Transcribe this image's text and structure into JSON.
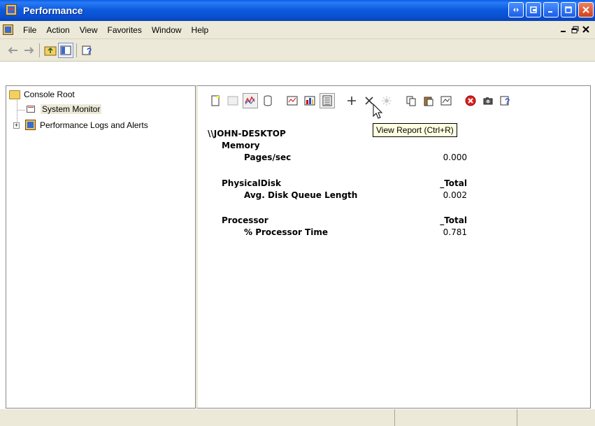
{
  "window": {
    "title": "Performance"
  },
  "menu": {
    "items": [
      "File",
      "Action",
      "View",
      "Favorites",
      "Window",
      "Help"
    ],
    "mdi": [
      "_",
      "ø",
      "x"
    ]
  },
  "tree": {
    "items": [
      {
        "label": "Console Root"
      },
      {
        "label": "System Monitor"
      },
      {
        "label": "Performance Logs and Alerts"
      }
    ]
  },
  "report": {
    "machine": "\\\\JOHN-DESKTOP",
    "objects": [
      {
        "name": "Memory",
        "instance": "",
        "counter": "Pages/sec",
        "value": "0.000"
      },
      {
        "name": "PhysicalDisk",
        "instance": "_Total",
        "counter": "Avg. Disk Queue Length",
        "value": "0.002"
      },
      {
        "name": "Processor",
        "instance": "_Total",
        "counter": "% Processor Time",
        "value": "0.781"
      }
    ]
  },
  "tooltip": "View Report (Ctrl+R)",
  "icons": {
    "back": "arrow-left-icon",
    "forward": "arrow-right-icon",
    "up": "folder-up-icon",
    "tree": "show-tree-icon",
    "help": "help-icon"
  }
}
